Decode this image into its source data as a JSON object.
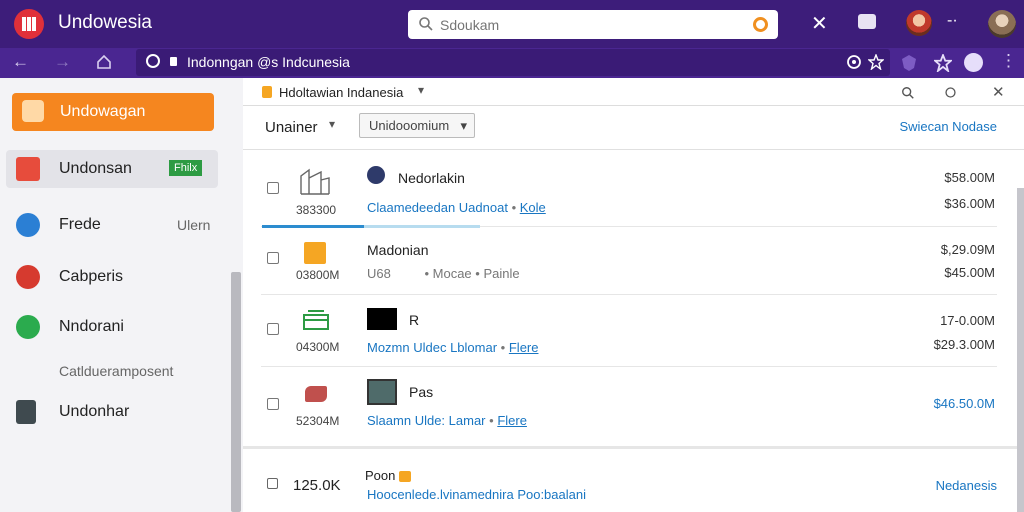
{
  "window": {
    "title": "Undowesia"
  },
  "search": {
    "placeholder": "Sdoukam"
  },
  "address": {
    "url": "Indonngan @s Indcunesia"
  },
  "sidebar": {
    "items": [
      {
        "label": "Undowagan"
      },
      {
        "label": "Undonsan",
        "badge": "Fhilx"
      },
      {
        "label": "Frede",
        "meta": "Ulern"
      },
      {
        "label": "Cabperis"
      },
      {
        "label": "Nndorani"
      },
      {
        "label": "Undonhar"
      }
    ],
    "subheading": "Catldueramposent"
  },
  "tab": {
    "label": "Hdoltawian Indanesia"
  },
  "toolbar": {
    "filter_label": "Unainer",
    "select_value": "Unidooomium",
    "link": "Swiecan Nodase"
  },
  "rows": [
    {
      "code": "383300",
      "title": "Nedorlakin",
      "sub_link": "Claamedeedan Uadnoat",
      "sub_sep": "•",
      "sub_tail": "Kole",
      "amount1": "$58.00M",
      "amount2": "$36.00M"
    },
    {
      "code": "03800M",
      "title": "Madonian",
      "sub_link": "U68",
      "sub_sep": "",
      "sub_tail": "• Mocae • Painle",
      "amount1": "$,29.09M",
      "amount2": "$45.00M"
    },
    {
      "code": "04300M",
      "title": "R",
      "sub_link": "Mozmn Uldec  Lblomar",
      "sub_sep": "•",
      "sub_tail": "Flere",
      "amount1": "17-0.00M",
      "amount2": "$29.3.00M"
    },
    {
      "code": "52304M",
      "title": "Pas",
      "sub_link": "Slaamn Ulde:  Lamar",
      "sub_sep": "•",
      "sub_tail": "Flere",
      "amount1": "$46.50.0M",
      "amount2": ""
    }
  ],
  "footer": {
    "count": "125.0K",
    "title": "Poon",
    "link": "Hoocenlede.lvinamednira Poo:baalani",
    "right_link": "Nedanesis"
  },
  "colors": {
    "titlebar": "#3d1d7a",
    "accent_orange": "#f5861f",
    "link_blue": "#1976c2",
    "badge_green": "#2d9b43"
  },
  "progress": {
    "fraction": 0.47
  }
}
